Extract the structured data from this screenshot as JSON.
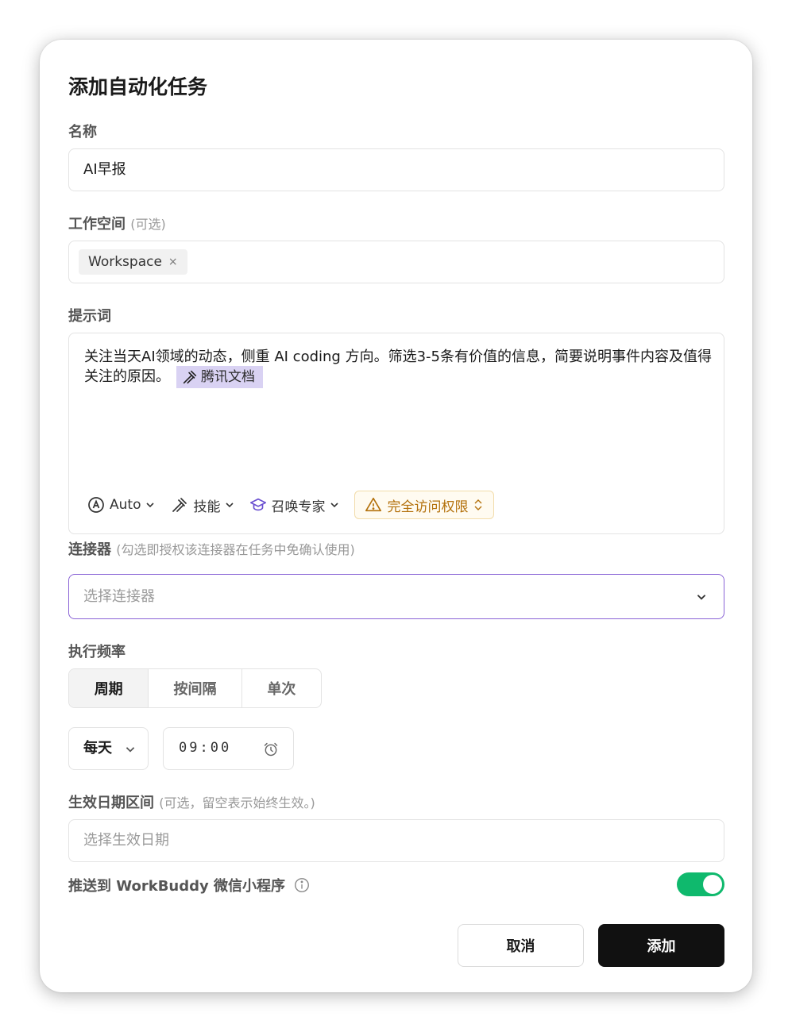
{
  "dialog": {
    "title": "添加自动化任务",
    "name_label": "名称",
    "name_value": "AI早报",
    "workspace_label": "工作空间",
    "workspace_hint": "(可选)",
    "workspace_chip": "Workspace",
    "workspace_chip_remove": "×",
    "prompt_label": "提示词",
    "prompt_text": "关注当天AI领域的动态，侧重 AI coding 方向。筛选3-5条有价值的信息，简要说明事件内容及值得关注的原因。",
    "prompt_tag": "腾讯文档",
    "toolbar": {
      "model": "Auto",
      "skills": "技能",
      "experts": "召唤专家",
      "permission": "完全访问权限"
    },
    "connector_label": "连接器",
    "connector_hint": "(勾选即授权该连接器在任务中免确认使用)",
    "connector_placeholder": "选择连接器",
    "frequency_label": "执行频率",
    "frequency_tabs": [
      "周期",
      "按间隔",
      "单次"
    ],
    "frequency_active": "周期",
    "period_value": "每天",
    "time_value": "09:00",
    "date_label": "生效日期区间",
    "date_hint": "(可选，留空表示始终生效。)",
    "date_placeholder": "选择生效日期",
    "push_label": "推送到 WorkBuddy 微信小程序",
    "push_enabled": true,
    "cancel_label": "取消",
    "add_label": "添加"
  },
  "colors": {
    "accent": "#8a64d6",
    "toggle_on": "#0fb96d",
    "warning": "#b3700a",
    "tag_bg": "#d9d2f3",
    "primary_button": "#111111"
  }
}
